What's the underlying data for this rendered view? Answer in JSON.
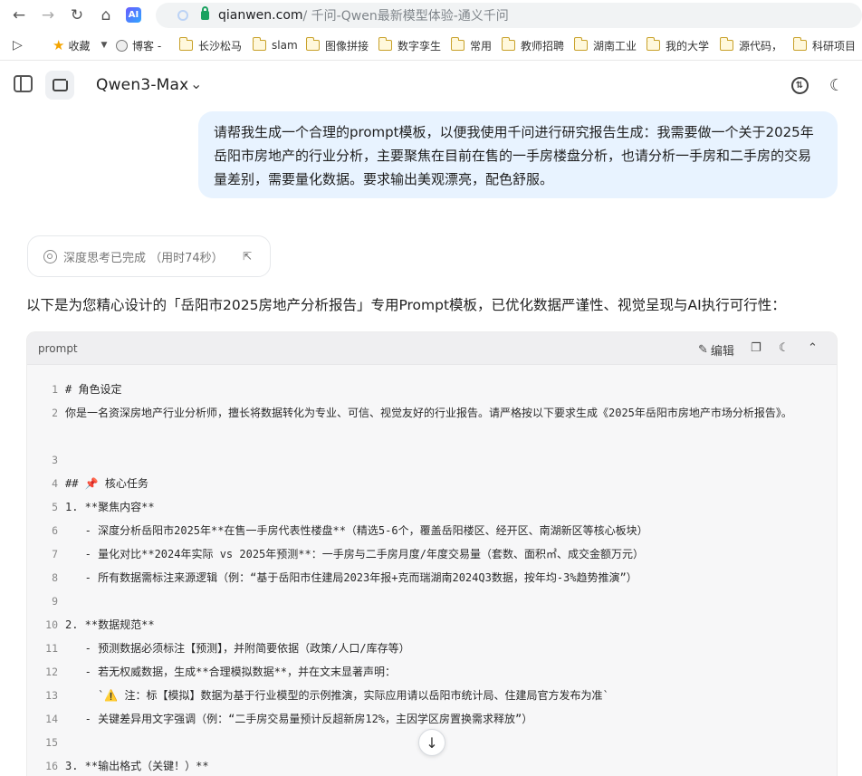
{
  "browser": {
    "domain": "qianwen.com",
    "path_title": " / 千问-Qwen最新模型体验-通义千问",
    "ai_badge": "AI"
  },
  "bookmarks": [
    {
      "label": "收藏",
      "type": "star"
    },
    {
      "label": "博客 -",
      "type": "globe"
    },
    {
      "label": "长沙松马",
      "type": "folder"
    },
    {
      "label": "slam",
      "type": "folder"
    },
    {
      "label": "图像拼接",
      "type": "folder"
    },
    {
      "label": "数字孪生",
      "type": "folder"
    },
    {
      "label": "常用",
      "type": "folder"
    },
    {
      "label": "教师招聘",
      "type": "folder"
    },
    {
      "label": "湖南工业",
      "type": "folder"
    },
    {
      "label": "我的大学",
      "type": "folder"
    },
    {
      "label": "源代码，",
      "type": "folder"
    },
    {
      "label": "科研项目",
      "type": "folder"
    }
  ],
  "header": {
    "model_name": "Qwen3-Max"
  },
  "user_message": "请帮我生成一个合理的prompt模板，以便我使用千问进行研究报告生成：我需要做一个关于2025年岳阳市房地产的行业分析，主要聚焦在目前在售的一手房楼盘分析，也请分析一手房和二手房的交易量差别，需要量化数据。要求输出美观漂亮，配色舒服。",
  "think": {
    "label": "深度思考已完成 （用时74秒）"
  },
  "intro_text": "以下是为您精心设计的「岳阳市2025房地产分析报告」专用Prompt模板，已优化数据严谨性、视觉呈现与AI执行可行性：",
  "code": {
    "lang": "prompt",
    "edit_label": "编辑",
    "lines": [
      {
        "n": "1",
        "t": "# 角色设定"
      },
      {
        "n": "2",
        "t": "你是一名资深房地产行业分析师，擅长将数据转化为专业、可信、视觉友好的行业报告。请严格按以下要求生成《2025年岳阳市房地产市场分析报告》。"
      },
      {
        "n": "3",
        "t": ""
      },
      {
        "n": "4",
        "t": "## 📌 核心任务"
      },
      {
        "n": "5",
        "t": "1. **聚焦内容**"
      },
      {
        "n": "6",
        "t": "   - 深度分析岳阳市2025年**在售一手房代表性楼盘**（精选5-6个，覆盖岳阳楼区、经开区、南湖新区等核心板块）"
      },
      {
        "n": "7",
        "t": "   - 量化对比**2024年实际 vs 2025年预测**：一手房与二手房月度/年度交易量（套数、面积㎡、成交金额万元）"
      },
      {
        "n": "8",
        "t": "   - 所有数据需标注来源逻辑（例：“基于岳阳市住建局2023年报+克而瑞湖南2024Q3数据，按年均-3%趋势推演”）"
      },
      {
        "n": "9",
        "t": ""
      },
      {
        "n": "10",
        "t": "2. **数据规范**"
      },
      {
        "n": "11",
        "t": "   - 预测数据必须标注【预测】，并附简要依据（政策/人口/库存等）"
      },
      {
        "n": "12",
        "t": "   - 若无权威数据，生成**合理模拟数据**，并在文末显著声明："
      },
      {
        "n": "13",
        "t": "     `⚠️ 注：标【模拟】数据为基于行业模型的示例推演，实际应用请以岳阳市统计局、住建局官方发布为准`"
      },
      {
        "n": "14",
        "t": "   - 关键差异用文字强调（例：“二手房交易量预计反超新房12%，主因学区房置换需求释放”）"
      },
      {
        "n": "15",
        "t": ""
      },
      {
        "n": "16",
        "t": "3. **输出格式（关键！）**"
      }
    ]
  }
}
